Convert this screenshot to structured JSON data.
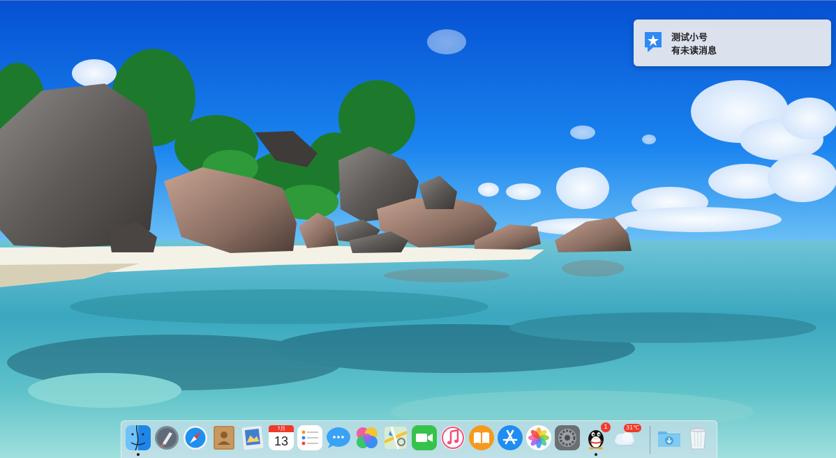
{
  "notification": {
    "title": "测试小号",
    "message": "有未读消息",
    "icon": "dingtalk-icon",
    "accent": "#2f8af5"
  },
  "dock": {
    "items": [
      {
        "name": "finder-icon",
        "running": true
      },
      {
        "name": "launchpad-icon"
      },
      {
        "name": "safari-icon"
      },
      {
        "name": "contacts-icon"
      },
      {
        "name": "preview-icon"
      },
      {
        "name": "calendar-icon",
        "month": "7月",
        "day": "13"
      },
      {
        "name": "reminders-icon"
      },
      {
        "name": "messages-icon"
      },
      {
        "name": "photo-booth-icon"
      },
      {
        "name": "maps-icon"
      },
      {
        "name": "facetime-icon"
      },
      {
        "name": "music-icon"
      },
      {
        "name": "books-icon"
      },
      {
        "name": "app-store-icon"
      },
      {
        "name": "photos-icon"
      },
      {
        "name": "system-preferences-icon"
      },
      {
        "name": "qq-icon",
        "badge": "1",
        "running": true
      },
      {
        "name": "weather-icon",
        "temp": "31℃"
      },
      {
        "name": "downloads-folder-icon"
      },
      {
        "name": "trash-icon"
      }
    ]
  },
  "colors": {
    "sky": "#0a63d8",
    "sea": "#48b8c8",
    "sand": "#f4f1e6",
    "badge": "#f23a2e"
  }
}
